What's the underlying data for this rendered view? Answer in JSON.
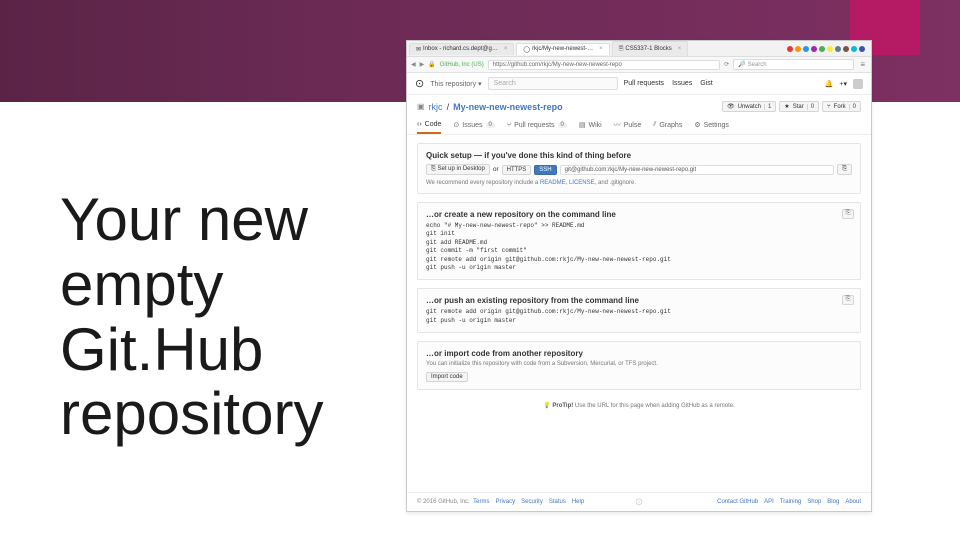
{
  "slide": {
    "title": "Your new empty Git.Hub repository"
  },
  "browser": {
    "tabs": [
      {
        "icon": "✉",
        "label": "Inbox - richard.cs.dept@g…"
      },
      {
        "icon": "◯",
        "label": "rkjc/My-new-newest-…"
      },
      {
        "icon": "🗎",
        "label": "CS5337-1 Blocks"
      }
    ],
    "url_prefix": "GitHub, Inc (US)",
    "url": "https://github.com/rkjc/My-new-new-newest-repo",
    "search_placeholder": "Search",
    "ext_colors": [
      "#e53935",
      "#ff9800",
      "#2196f3",
      "#9c27b0",
      "#4caf50",
      "#ffeb3b",
      "#607d8b",
      "#795548",
      "#00bcd4",
      "#3f51b5"
    ]
  },
  "github": {
    "nav_dropdown": "This repository",
    "search_placeholder": "Search",
    "nav_links": [
      "Pull requests",
      "Issues",
      "Gist"
    ],
    "owner": "rkjc",
    "repo": "My-new-new-newest-repo",
    "actions": {
      "unwatch": {
        "label": "Unwatch",
        "count": "1"
      },
      "star": {
        "label": "Star",
        "count": "0"
      },
      "fork": {
        "label": "Fork",
        "count": "0"
      }
    },
    "tabs": {
      "code": "Code",
      "issues": {
        "label": "Issues",
        "count": "0"
      },
      "pulls": {
        "label": "Pull requests",
        "count": "0"
      },
      "wiki": "Wiki",
      "pulse": "Pulse",
      "graphs": "Graphs",
      "settings": "Settings"
    },
    "quick": {
      "title": "Quick setup — if you've done this kind of thing before",
      "setup_btn": "Set up in Desktop",
      "or": "or",
      "https": "HTTPS",
      "ssh": "SSH",
      "url": "git@github.com:rkjc/My-new-new-newest-repo.git",
      "hint_a": "We recommend every repository include a ",
      "hint_links": "README, LICENSE,",
      "hint_b": " and .gitignore."
    },
    "create": {
      "title": "…or create a new repository on the command line",
      "cmds": "echo \"# My-new-new-newest-repo\" >> README.md\ngit init\ngit add README.md\ngit commit -m \"first commit\"\ngit remote add origin git@github.com:rkjc/My-new-new-newest-repo.git\ngit push -u origin master"
    },
    "push": {
      "title": "…or push an existing repository from the command line",
      "cmds": "git remote add origin git@github.com:rkjc/My-new-new-newest-repo.git\ngit push -u origin master"
    },
    "import": {
      "title": "…or import code from another repository",
      "sub": "You can initialize this repository with code from a Subversion, Mercurial, or TFS project.",
      "btn": "Import code"
    },
    "protip": {
      "label": "ProTip!",
      "text": " Use the URL for this page when adding GitHub as a remote."
    },
    "footer": {
      "copyright": "© 2016 GitHub, Inc.",
      "left": [
        "Terms",
        "Privacy",
        "Security",
        "Status",
        "Help"
      ],
      "right": [
        "Contact GitHub",
        "API",
        "Training",
        "Shop",
        "Blog",
        "About"
      ]
    }
  }
}
